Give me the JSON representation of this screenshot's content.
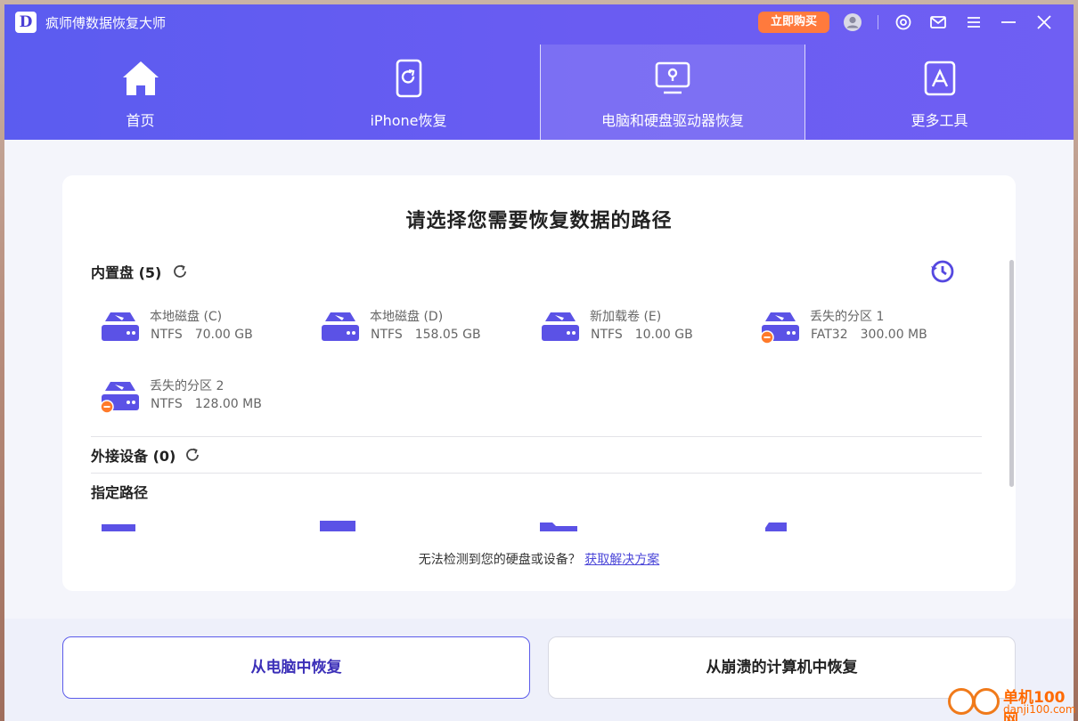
{
  "app": {
    "logo_letter": "D",
    "title": "疯师傅数据恢复大师",
    "buy_label": "立即购买"
  },
  "nav": {
    "tabs": [
      {
        "label": "首页",
        "icon": "home-icon"
      },
      {
        "label": "iPhone恢复",
        "icon": "phone-refresh-icon"
      },
      {
        "label": "电脑和硬盘驱动器恢复",
        "icon": "monitor-disk-icon",
        "active": true
      },
      {
        "label": "更多工具",
        "icon": "app-store-icon"
      }
    ]
  },
  "main": {
    "title": "请选择您需要恢复数据的路径",
    "internal": {
      "label": "内置盘 (5)",
      "disks": [
        {
          "name": "本地磁盘 (C)",
          "fs": "NTFS",
          "size": "70.00 GB",
          "lost": false
        },
        {
          "name": "本地磁盘 (D)",
          "fs": "NTFS",
          "size": "158.05 GB",
          "lost": false
        },
        {
          "name": "新加载卷 (E)",
          "fs": "NTFS",
          "size": "10.00 GB",
          "lost": false
        },
        {
          "name": "丢失的分区 1",
          "fs": "FAT32",
          "size": "300.00 MB",
          "lost": true
        },
        {
          "name": "丢失的分区 2",
          "fs": "NTFS",
          "size": "128.00 MB",
          "lost": true
        }
      ]
    },
    "external": {
      "label": "外接设备 (0)"
    },
    "specified": {
      "label": "指定路径"
    },
    "help_text": "无法检测到您的硬盘或设备？",
    "help_link": "获取解决方案"
  },
  "bottom": {
    "from_pc": "从电脑中恢复",
    "from_crashed": "从崩溃的计算机中恢复"
  },
  "watermark": {
    "text": "单机100网",
    "sub": "danji100.com"
  },
  "colors": {
    "accent": "#5b5cf0",
    "lost_badge": "#ff7a2a",
    "buy": "#ff7a3d",
    "link": "#4b46d8"
  }
}
